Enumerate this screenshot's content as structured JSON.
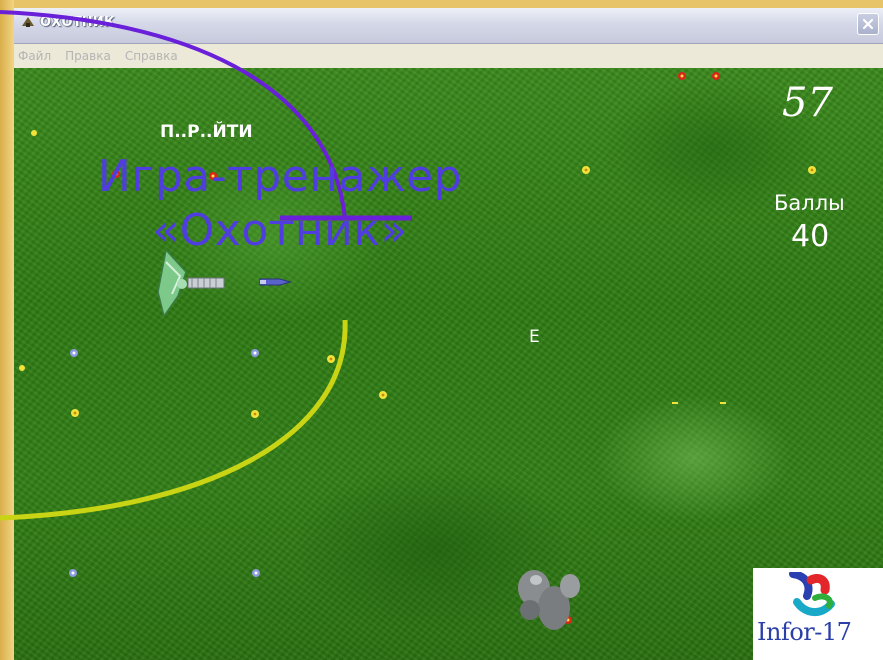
{
  "window": {
    "title": "ОХОТНИК",
    "menu": [
      "Файл",
      "Правка",
      "Справка"
    ]
  },
  "game": {
    "timer": "57",
    "score_label": "Баллы",
    "score_value": "40",
    "word_puzzle": "П..Р..ЙТИ",
    "target_letter": "Е"
  },
  "overlay": {
    "title_line1": "Игра-тренажер",
    "title_line2": "«Охотник»"
  },
  "logo": {
    "text": "Infor-17"
  },
  "colors": {
    "overlay_text": "#4f3de0",
    "upper_arc": "#6a1fd9",
    "lower_arc": "#c8d414",
    "grass": "#2f7a12"
  }
}
